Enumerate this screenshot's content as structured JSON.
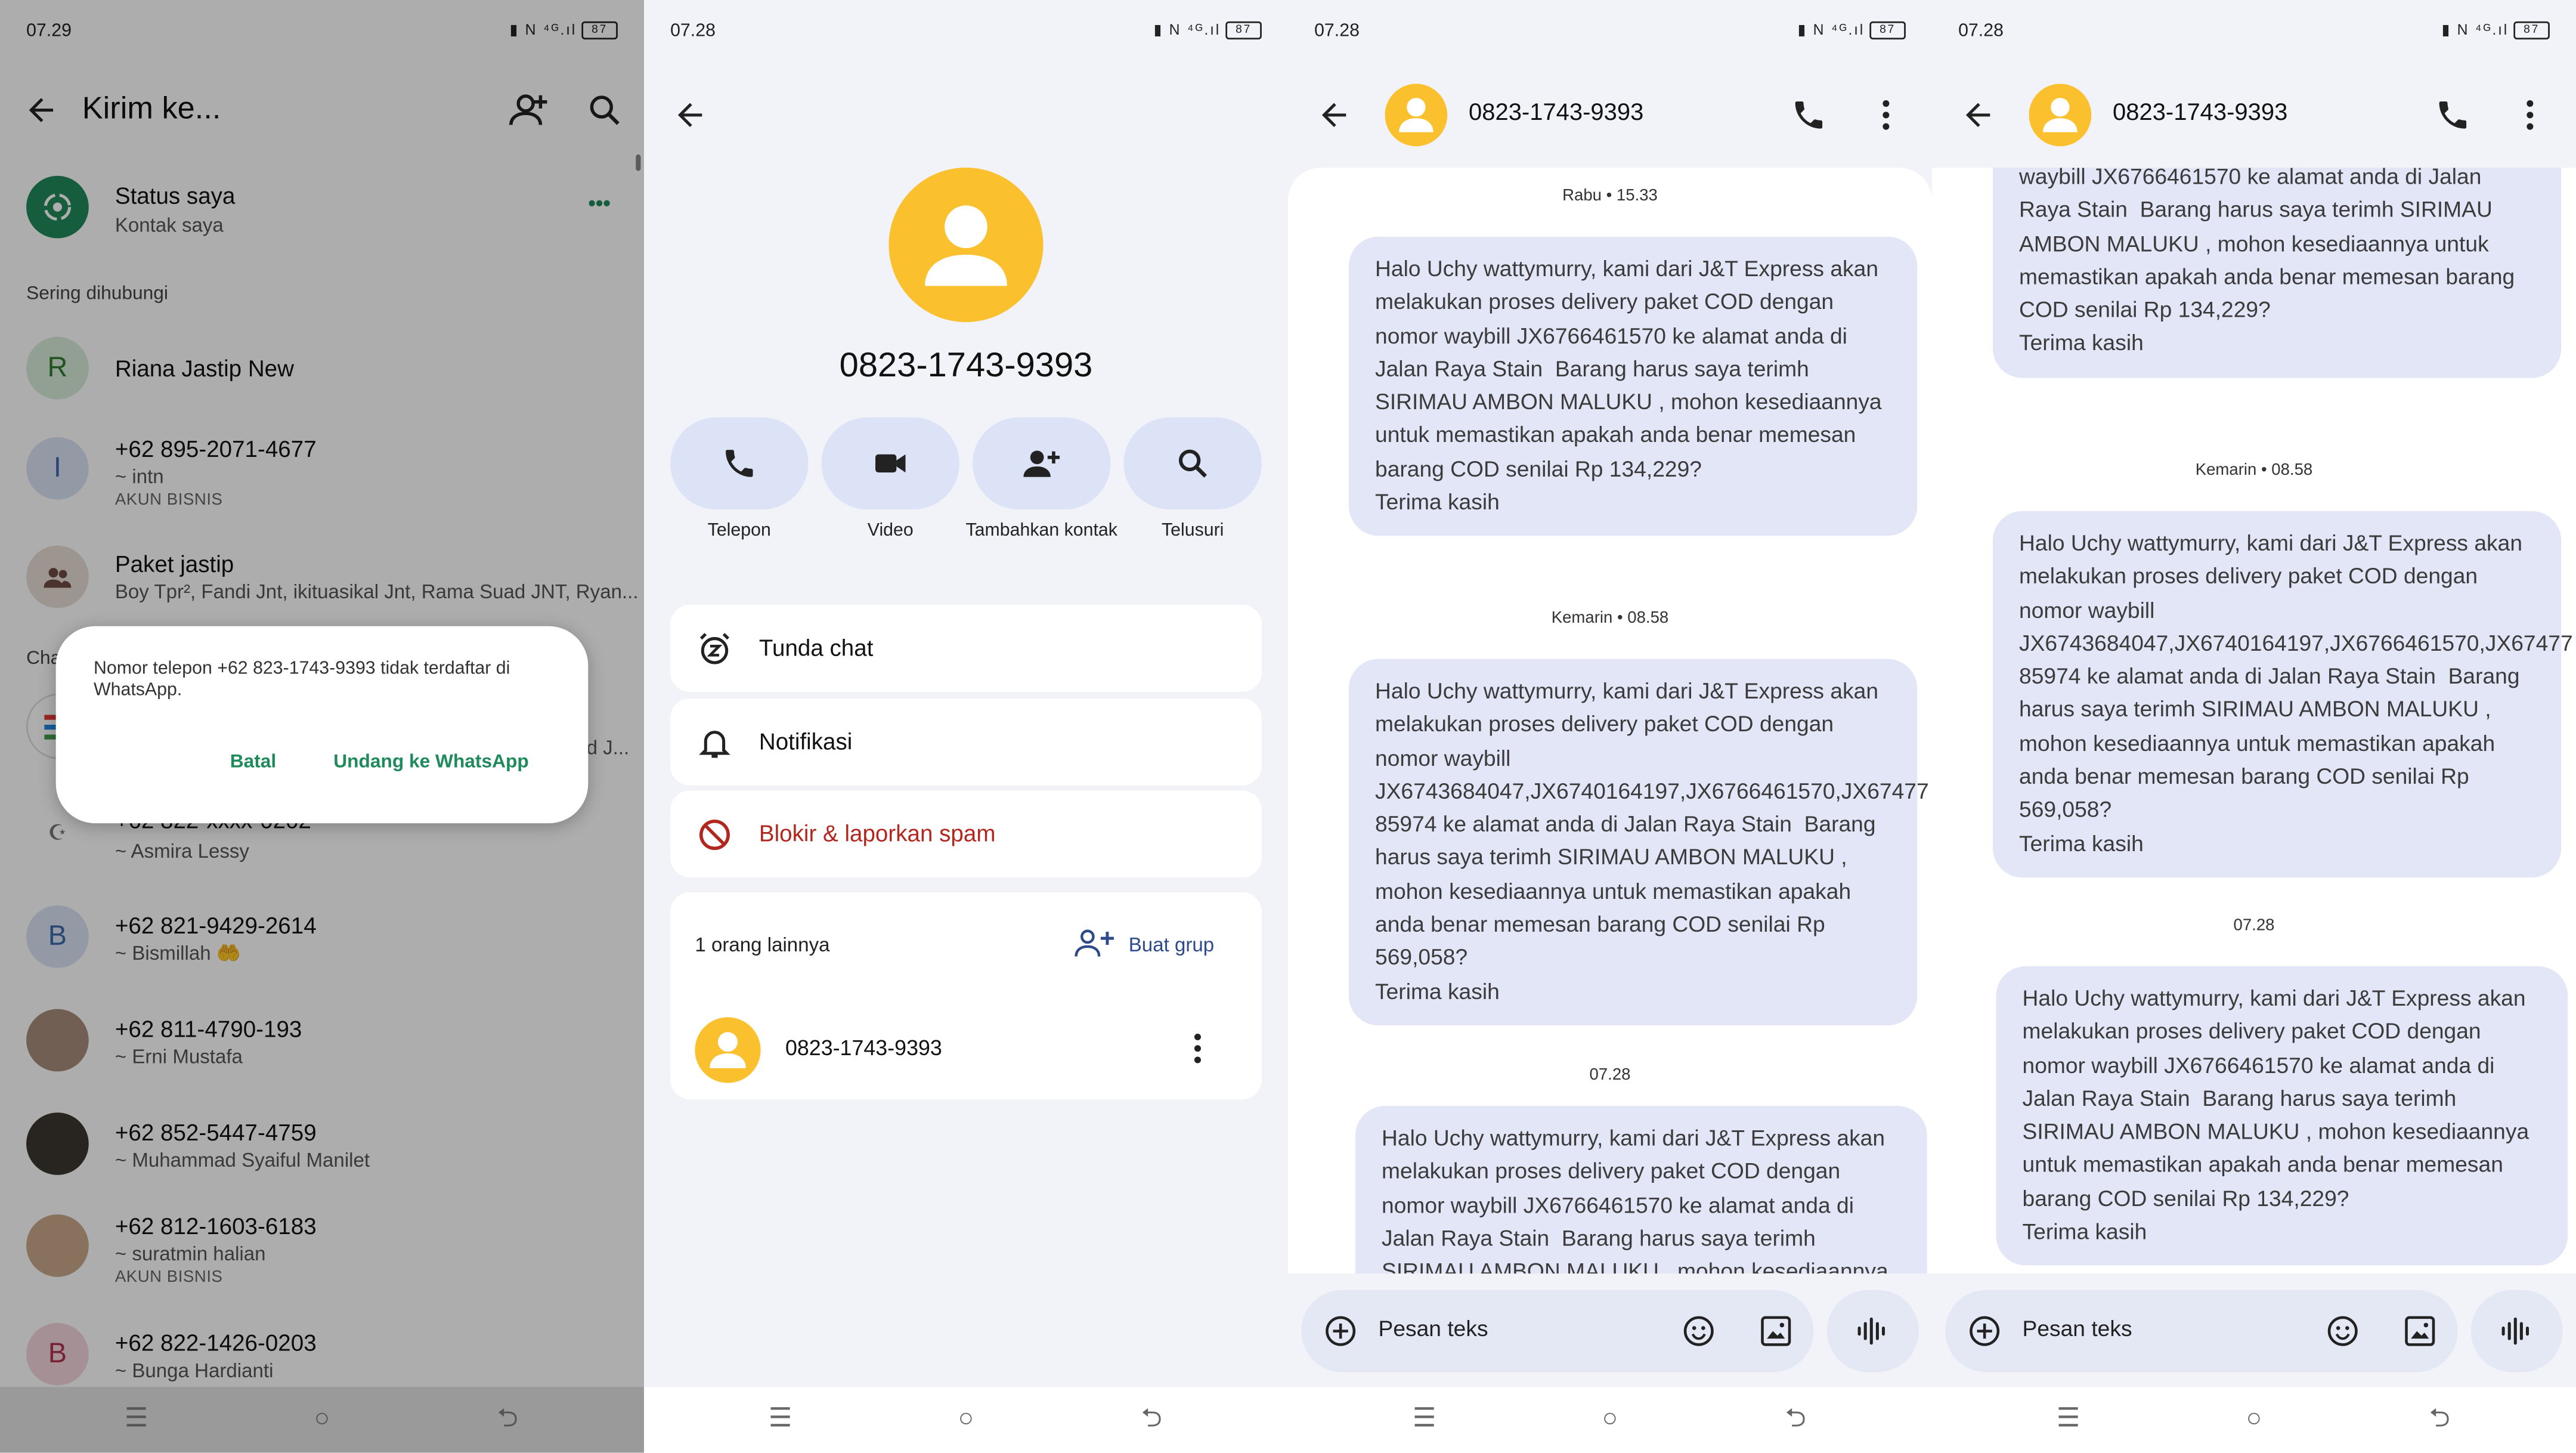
{
  "panel1": {
    "status_time": "07.29",
    "status_battery": "87",
    "title": "Kirim ke...",
    "status_row": {
      "title": "Status saya",
      "subtitle": "Kontak saya",
      "more": "•••"
    },
    "section_frequent": "Sering dihubungi",
    "section_chats_partial": "Cha",
    "contacts": [
      {
        "initial": "R",
        "title": "Riana Jastip New",
        "subtitle": "",
        "tag": "",
        "color": "#d7ead9",
        "fg": "#2e7d32"
      },
      {
        "initial": "I",
        "title": "+62 895-2071-4677",
        "subtitle": "~ intn",
        "tag": "AKUN BISNIS",
        "color": "#d9e4f3",
        "fg": "#3b69a8"
      },
      {
        "initial": "",
        "title": "Paket jastip",
        "subtitle": "Boy Tpr², Fandi Jnt, ikituasikal Jnt, Rama Suad JNT, Ryan...",
        "tag": "",
        "color": "#e6dcd5",
        "fg": "#6d4c41"
      },
      {
        "initial": "",
        "title": "",
        "subtitle": "d J...",
        "tag": "",
        "color": "#ffffff",
        "fg": "#333"
      },
      {
        "initial": "",
        "title": "+62 822-xxxx-0202",
        "subtitle": "~ Asmira Lessy",
        "tag": "",
        "color": "#ffffff",
        "fg": "#333"
      },
      {
        "initial": "B",
        "title": "+62 821-9429-2614",
        "subtitle": "~ Bismillah 🤲",
        "tag": "",
        "color": "#d9e4f3",
        "fg": "#3b69a8"
      },
      {
        "initial": "",
        "title": "+62 811-4790-193",
        "subtitle": "~ Erni Mustafa",
        "tag": "",
        "color": "#a98d7b",
        "fg": "#fff"
      },
      {
        "initial": "",
        "title": "+62 852-5447-4759",
        "subtitle": "~ Muhammad Syaiful Manilet",
        "tag": "",
        "color": "#3b3630",
        "fg": "#fff"
      },
      {
        "initial": "",
        "title": "+62 812-1603-6183",
        "subtitle": "~ suratmin halian",
        "tag": "AKUN BISNIS",
        "color": "#c9a88a",
        "fg": "#fff"
      },
      {
        "initial": "B",
        "title": "+62 822-1426-0203",
        "subtitle": "~ Bunga Hardianti",
        "tag": "",
        "color": "#f3d5dc",
        "fg": "#b0344f"
      }
    ],
    "dialog": {
      "message": "Nomor telepon +62 823-1743-9393 tidak terdaftar di WhatsApp.",
      "cancel": "Batal",
      "invite": "Undang ke WhatsApp"
    }
  },
  "panel2": {
    "status_time": "07.28",
    "status_battery": "87",
    "phone": "0823-1743-9393",
    "actions": [
      "Telepon",
      "Video",
      "Tambahkan kontak",
      "Telusuri"
    ],
    "menu": [
      "Tunda chat",
      "Notifikasi",
      "Blokir & laporkan spam"
    ],
    "others_label": "1 orang lainnya",
    "make_group": "Buat grup",
    "member_phone": "0823-1743-9393"
  },
  "panel3": {
    "status_time": "07.28",
    "status_battery": "87",
    "phone": "0823-1743-9393",
    "time1": "Rabu • 15.33",
    "msg1": "Halo Uchy wattymurry, kami dari J&T Express akan melakukan proses delivery paket COD dengan nomor waybill JX6766461570 ke alamat anda di Jalan Raya Stain  Barang harus saya terimh SIRIMAU AMBON MALUKU , mohon kesediaannya untuk memastikan apakah anda benar memesan barang COD senilai Rp 134,229?\nTerima kasih",
    "time2": "Kemarin • 08.58",
    "msg2": "Halo Uchy wattymurry, kami dari J&T Express akan melakukan proses delivery paket COD dengan nomor waybill JX6743684047,JX6740164197,JX6766461570,JX67477 85974 ke alamat anda di Jalan Raya Stain  Barang harus saya terimh SIRIMAU AMBON MALUKU , mohon kesediaannya untuk memastikan apakah anda benar memesan barang COD senilai Rp 569,058?\nTerima kasih",
    "time3": "07.28",
    "msg3": "Halo Uchy wattymurry, kami dari J&T Express akan melakukan proses delivery paket COD dengan nomor waybill JX6766461570 ke alamat anda di Jalan Raya Stain  Barang harus saya terimh SIRIMAU AMBON MALUKU , mohon kesediaannya untuk memastikan",
    "placeholder": "Pesan teks"
  },
  "panel4": {
    "status_time": "07.28",
    "status_battery": "87",
    "phone": "0823-1743-9393",
    "msg1_partial": "waybill JX6766461570 ke alamat anda di Jalan Raya Stain  Barang harus saya terimh SIRIMAU AMBON MALUKU , mohon kesediaannya untuk memastikan apakah anda benar memesan barang COD senilai Rp 134,229?\nTerima kasih",
    "time2": "Kemarin • 08.58",
    "msg2": "Halo Uchy wattymurry, kami dari J&T Express akan melakukan proses delivery paket COD dengan nomor waybill\nJX6743684047,JX6740164197,JX6766461570,JX67477 85974 ke alamat anda di Jalan Raya Stain  Barang harus saya terimh SIRIMAU AMBON MALUKU , mohon kesediaannya untuk memastikan apakah anda benar memesan barang COD senilai Rp 569,058?\nTerima kasih",
    "time3": "07.28",
    "msg3": "Halo Uchy wattymurry, kami dari J&T Express akan melakukan proses delivery paket COD dengan nomor waybill JX6766461570 ke alamat anda di Jalan Raya Stain  Barang harus saya terimh SIRIMAU AMBON MALUKU , mohon kesediaannya untuk memastikan apakah anda benar memesan barang COD senilai Rp 134,229?\nTerima kasih",
    "placeholder": "Pesan teks"
  },
  "colors": {
    "whatsapp_green": "#1f8a5b",
    "accent_yellow": "#fbc02d",
    "bubble": "#e2e6f7",
    "danger": "#b3261e"
  }
}
